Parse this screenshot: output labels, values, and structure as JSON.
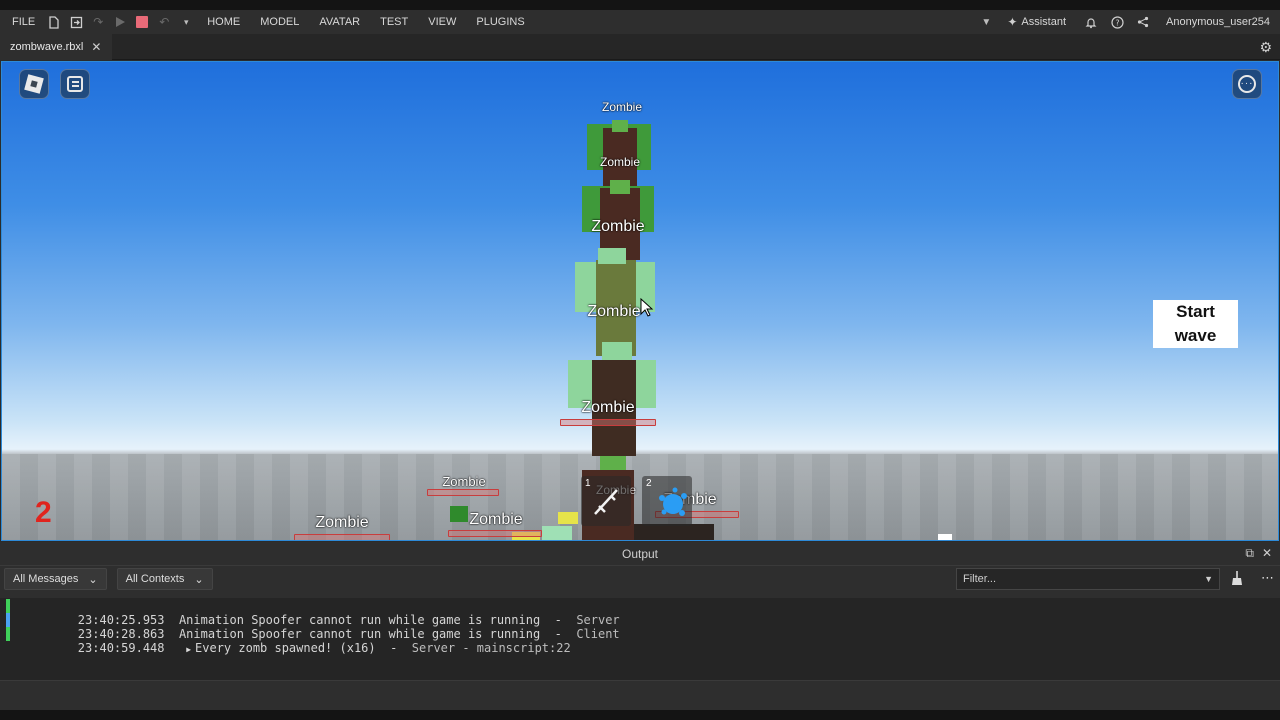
{
  "menu": {
    "file": "FILE",
    "items": [
      "HOME",
      "MODEL",
      "AVATAR",
      "TEST",
      "VIEW",
      "PLUGINS"
    ],
    "assistant": "Assistant",
    "user": "Anonymous_user254"
  },
  "tab": {
    "title": "zombwave.rbxl",
    "close": "✕"
  },
  "viewport": {
    "zombie_label": "Zombie",
    "start_wave_line1": "Start",
    "start_wave_line2": "wave",
    "wave_number": "2",
    "hotbar_slots": [
      "1",
      "2"
    ]
  },
  "output": {
    "title": "Output",
    "messages_filter": "All Messages",
    "contexts_filter": "All Contexts",
    "filter_placeholder": "Filter...",
    "logs": [
      {
        "time": "23:40:25.953",
        "message": "Animation Spoofer cannot run while game is running",
        "source": "Server",
        "color": "#3fd05a"
      },
      {
        "time": "23:40:28.863",
        "message": "Animation Spoofer cannot run while game is running",
        "source": "Client",
        "color": "#4aa3f2"
      },
      {
        "time": "23:40:59.448",
        "message": "Every zomb spawned! (x16)",
        "source": "Server - mainscript:22",
        "color": "#3fd05a"
      }
    ]
  }
}
